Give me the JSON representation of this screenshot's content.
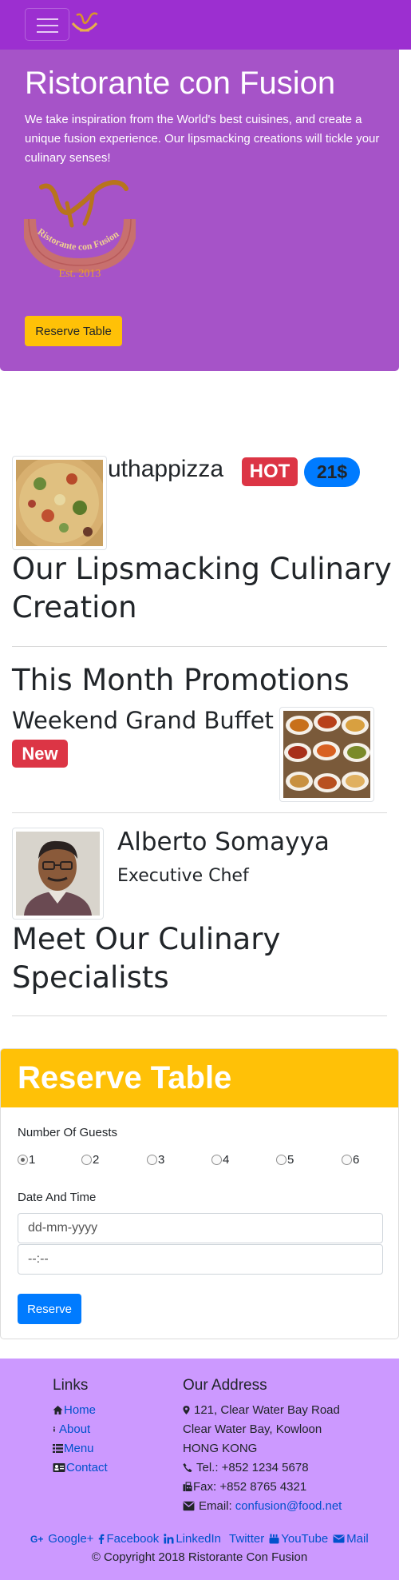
{
  "navbar": {
    "toggle_icon": "hamburger-icon",
    "logo_icon": "restaurant-logo-icon"
  },
  "hero": {
    "title": "Ristorante con Fusion",
    "text": "We take inspiration from the World's best cuisines, and create a unique fusion experience. Our lipsmacking creations will tickle your culinary senses!",
    "logo_text": "Ristorante con Fusion",
    "logo_est": "Est. 2013",
    "button": "Reserve Table"
  },
  "dish": {
    "name": "uthappizza",
    "badge": "HOT",
    "price": "21$",
    "section_title": "Our Lipsmacking Culinary Creation"
  },
  "promotion": {
    "section_title": "This Month Promotions",
    "name": "Weekend Grand Buffet",
    "badge": "New"
  },
  "leader": {
    "name": "Alberto Somayya",
    "role": "Executive Chef",
    "section_title": "Meet Our Culinary Specialists"
  },
  "reserve": {
    "title": "Reserve Table",
    "guests_label": "Number Of Guests",
    "guests": [
      "1",
      "2",
      "3",
      "4",
      "5",
      "6"
    ],
    "selected_guests": "1",
    "datetime_label": "Date And Time",
    "date_placeholder": "dd-mm-yyyy",
    "time_placeholder": "--:--",
    "submit": "Reserve"
  },
  "footer": {
    "links_heading": "Links",
    "links": [
      {
        "label": "Home",
        "icon": "home-icon"
      },
      {
        "label": "About",
        "icon": "info-icon"
      },
      {
        "label": "Menu",
        "icon": "list-icon"
      },
      {
        "label": "Contact",
        "icon": "address-card-icon"
      }
    ],
    "address_heading": "Our Address",
    "address_lines": [
      "121, Clear Water Bay Road",
      "Clear Water Bay, Kowloon",
      "HONG KONG"
    ],
    "tel": "Tel.: +852 1234 5678",
    "fax": "Fax: +852 8765 4321",
    "email_label": "Email:",
    "email": "confusion@food.net",
    "social": [
      {
        "label": "Google+",
        "icon": "google-plus-icon"
      },
      {
        "label": "Facebook",
        "icon": "facebook-icon"
      },
      {
        "label": "LinkedIn",
        "icon": "linkedin-icon"
      },
      {
        "label": "Twitter",
        "icon": "twitter-icon"
      },
      {
        "label": "YouTube",
        "icon": "youtube-icon"
      },
      {
        "label": "Mail",
        "icon": "envelope-icon"
      }
    ],
    "copyright": "© Copyright 2018 Ristorante Con Fusion"
  },
  "colors": {
    "navbar": "#9c2fd0",
    "hero": "#a653c8",
    "warning": "#ffc107",
    "danger": "#dc3545",
    "primary": "#007bff",
    "footer": "#cc99ff"
  }
}
